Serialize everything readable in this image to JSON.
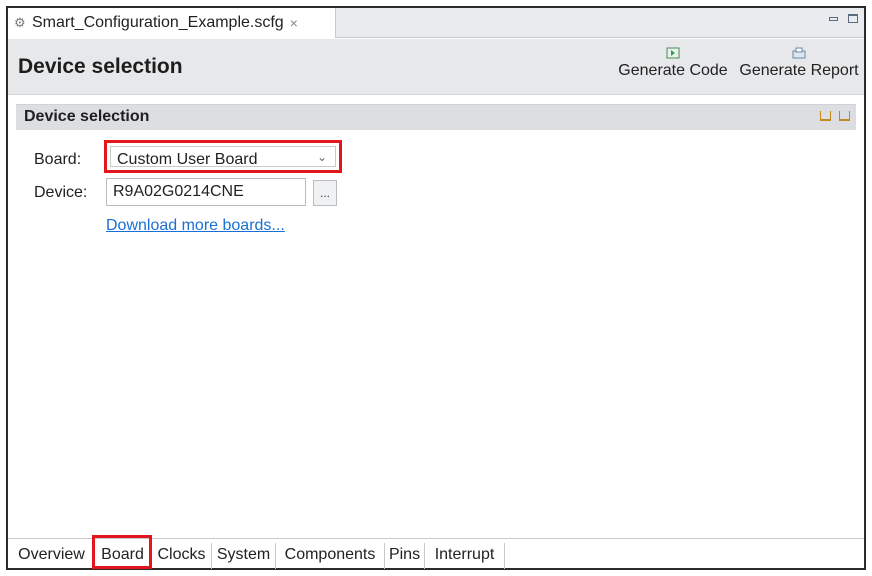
{
  "editor_tab": {
    "file_name": "Smart_Configuration_Example.scfg",
    "close_label": "×"
  },
  "header": {
    "title": "Device selection",
    "generate_code_label": "Generate Code",
    "generate_report_label": "Generate Report"
  },
  "section": {
    "title": "Device selection"
  },
  "form": {
    "board_label": "Board:",
    "board_value": "Custom User Board",
    "device_label": "Device:",
    "device_value": "R9A02G0214CNE",
    "browse_label": "...",
    "download_link": "Download more boards..."
  },
  "bottom_tabs": [
    "Overview",
    "Board",
    "Clocks",
    "System",
    "Components",
    "Pins",
    "Interrupt"
  ],
  "selected_tab": "Board",
  "colors": {
    "highlight": "#e2161b",
    "link": "#1a6fd6",
    "accent": "#2d6fd1"
  }
}
